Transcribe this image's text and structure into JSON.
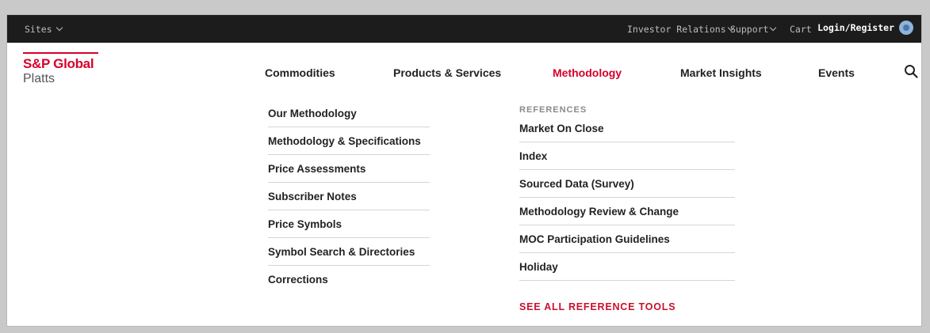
{
  "topbar": {
    "sites_label": "Sites",
    "investor_relations": "Investor Relations",
    "support": "Support",
    "cart": "Cart",
    "login": "Login/Register"
  },
  "logo": {
    "line1": "S&P Global",
    "line2": "Platts"
  },
  "nav": {
    "items": [
      "Commodities",
      "Products & Services",
      "Methodology",
      "Market Insights",
      "Events"
    ],
    "active": "Methodology"
  },
  "dropdown": {
    "left_links": [
      "Our Methodology",
      "Methodology & Specifications",
      "Price Assessments",
      "Subscriber Notes",
      "Price Symbols",
      "Symbol Search & Directories",
      "Corrections"
    ],
    "references_heading": "REFERENCES",
    "right_links": [
      "Market On Close",
      "Index",
      "Sourced Data (Survey)",
      "Methodology Review & Change",
      "MOC Participation Guidelines",
      "Holiday"
    ],
    "see_all": "SEE ALL REFERENCE TOOLS"
  },
  "colors": {
    "brand_red": "#d6002a",
    "topbar_bg": "#1c1c1c"
  }
}
